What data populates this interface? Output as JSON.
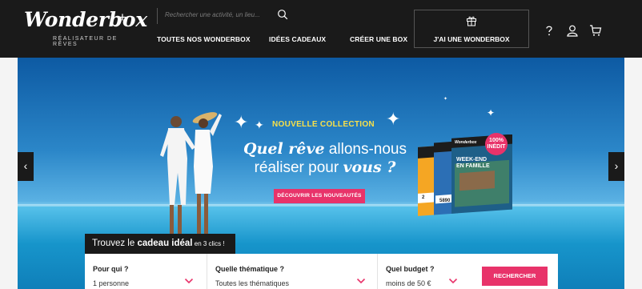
{
  "header": {
    "logo_text": "Wonderbox",
    "logo_plus": "+",
    "tagline": "RÉALISATEUR DE RÊVES",
    "search_placeholder": "Rechercher une activité, un lieu...",
    "nav": [
      "TOUTES NOS WONDERBOX",
      "IDÉES CADEAUX",
      "CRÉER UNE BOX"
    ],
    "owner_label": "J'AI UNE WONDERBOX",
    "icons": [
      "search-icon",
      "gift-icon",
      "help-icon",
      "user-icon",
      "cart-icon"
    ]
  },
  "hero": {
    "collection": "NOUVELLE COLLECTION",
    "headline_a": "Quel rêve",
    "headline_b": " allons-nous",
    "headline_c": "réaliser pour ",
    "headline_d": "vous ?",
    "cta": "DÉCOUVRIR LES NOUVEAUTÉS",
    "badge_a": "100%",
    "badge_b": "INÉDIT",
    "box_title_a": "WEEK-END",
    "box_title_b": "EN FAMILLE",
    "box_brand": "Wonderbox",
    "box_price": "5890",
    "box_price_2": "2",
    "prev_label": "‹",
    "next_label": "›"
  },
  "finder": {
    "tab_a": "Trouvez le ",
    "tab_b": "cadeau idéal",
    "tab_c": " en 3 clics !",
    "who_label": "Pour qui ?",
    "who_value": "1 personne",
    "theme_label": "Quelle thématique ?",
    "theme_value": "Toutes les thématiques",
    "budget_label": "Quel budget ?",
    "budget_value": "moins de 50 €",
    "search_button": "RECHERCHER"
  },
  "colors": {
    "accent": "#e8336a",
    "header_bg": "#1a1a1a",
    "collection_yellow": "#f7e04a"
  }
}
